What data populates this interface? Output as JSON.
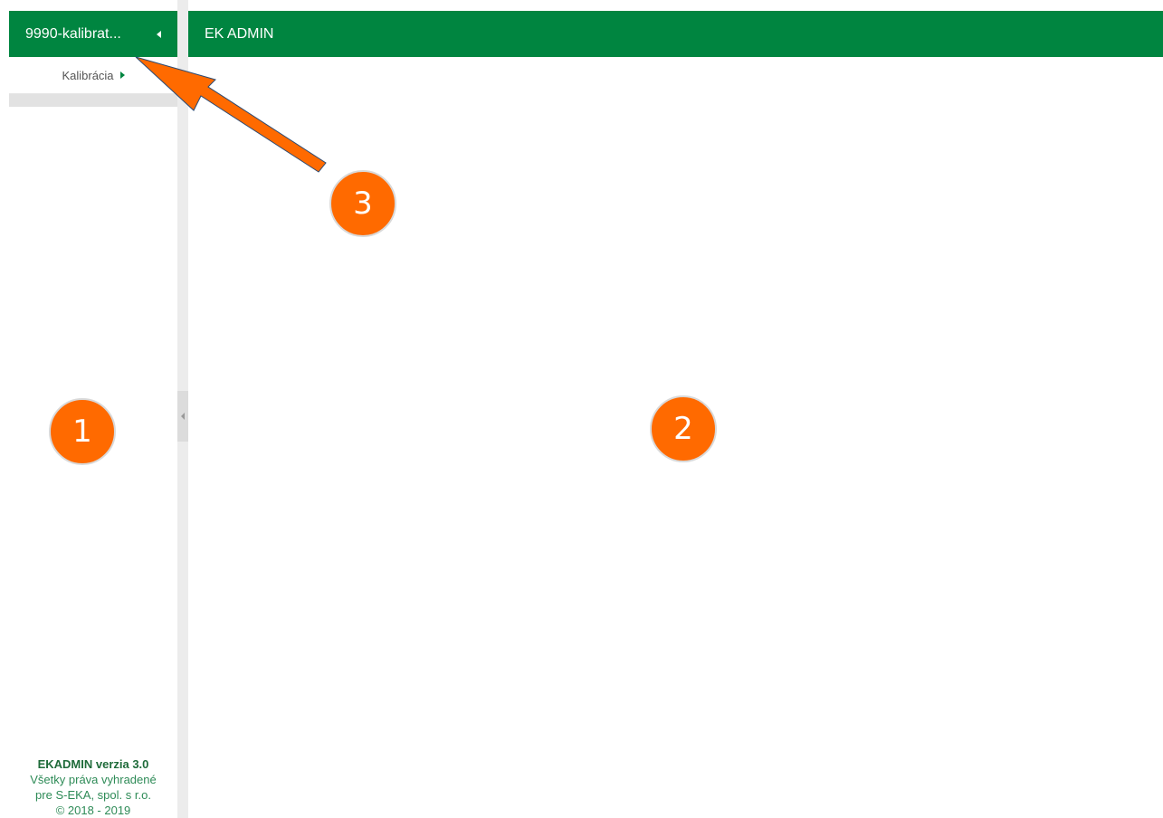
{
  "sidebar": {
    "title": "9990-kalibrat...",
    "menu": [
      {
        "label": "Kalibrácia"
      }
    ],
    "footer": {
      "version": "EKADMIN verzia 3.0",
      "rights": "Všetky práva vyhradené",
      "company": "pre S-EKA, spol. s r.o.",
      "copyright": "© 2018 - 2019"
    }
  },
  "topbar": {
    "title": "EK ADMIN"
  },
  "annotations": {
    "marker1": "1",
    "marker2": "2",
    "marker3": "3"
  },
  "colors": {
    "brand_green": "#008540",
    "annotation_orange": "#ff6a00"
  },
  "icons": {
    "collapse": "caret-left-icon",
    "submenu": "caret-right-icon"
  }
}
